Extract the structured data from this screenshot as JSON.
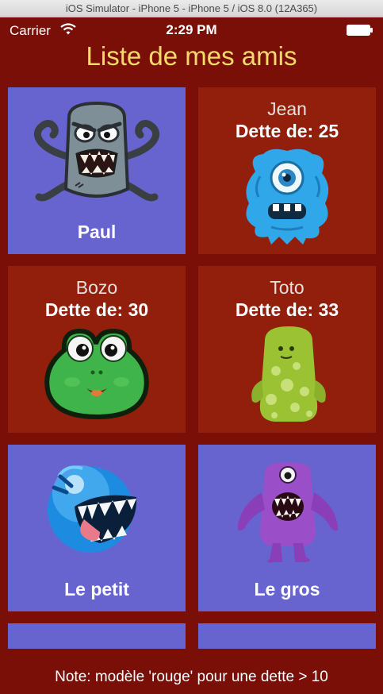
{
  "window": {
    "title": "iOS Simulator - iPhone 5 - iPhone 5 / iOS 8.0 (12A365)"
  },
  "status_bar": {
    "carrier": "Carrier",
    "time": "2:29 PM"
  },
  "app": {
    "title": "Liste de mes amis"
  },
  "friends": [
    {
      "name": "Paul",
      "debt_label": "",
      "style": "blue",
      "avatar": "zombie-monster-icon"
    },
    {
      "name": "Jean",
      "debt_label": "Dette de: 25",
      "style": "red",
      "avatar": "furry-blue-cyclops-icon"
    },
    {
      "name": "Bozo",
      "debt_label": "Dette de: 30",
      "style": "red",
      "avatar": "green-frog-monster-icon"
    },
    {
      "name": "Toto",
      "debt_label": "Dette de: 33",
      "style": "red",
      "avatar": "green-spotted-monster-icon"
    },
    {
      "name": "Le petit",
      "debt_label": "",
      "style": "blue",
      "avatar": "blue-fanged-ball-icon"
    },
    {
      "name": "Le gros",
      "debt_label": "",
      "style": "blue",
      "avatar": "purple-cyclops-monster-icon"
    }
  ],
  "footer": {
    "note": "Note: modèle 'rouge' pour une dette > 10"
  },
  "colors": {
    "background": "#7a0f08",
    "blue_tile": "#6764cf",
    "red_tile": "#921e0c",
    "title": "#f7d96b"
  }
}
